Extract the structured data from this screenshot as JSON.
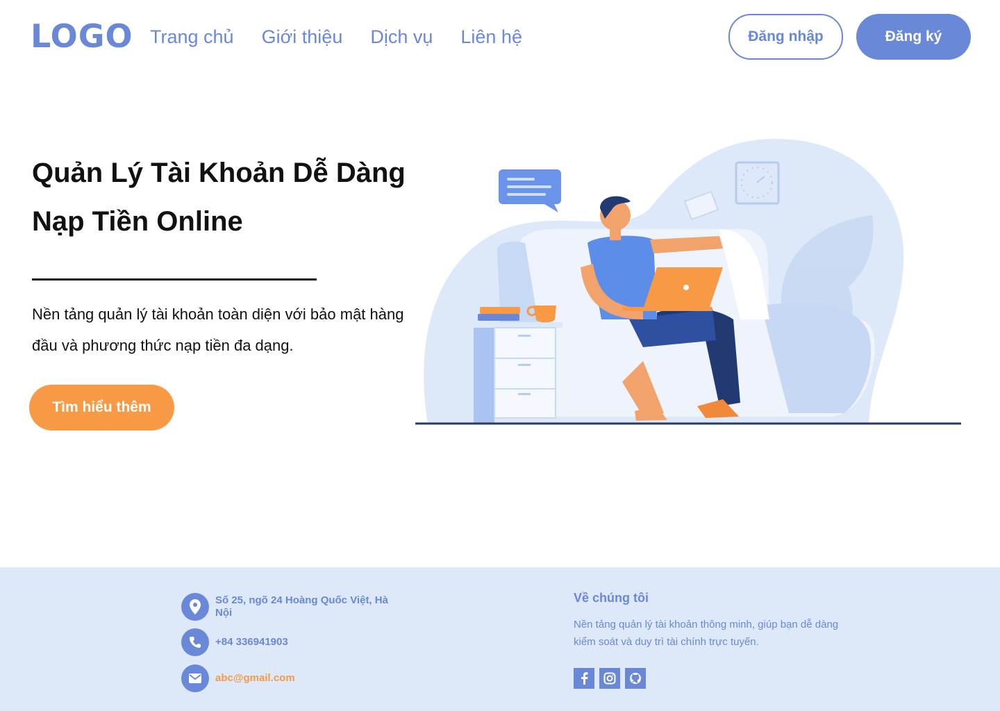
{
  "header": {
    "logo": "LOGO",
    "nav": [
      "Trang chủ",
      "Giới thiệu",
      "Dịch vụ",
      "Liên hệ"
    ],
    "login_label": "Đăng nhập",
    "register_label": "Đăng ký"
  },
  "hero": {
    "title_line1": "Quản Lý Tài Khoản Dễ Dàng",
    "title_line2": "Nạp Tiền Online",
    "description": "Nền tảng quản lý tài khoản toàn diện với bảo mật hàng đầu và phương thức nạp tiền đa dạng.",
    "cta_label": "Tìm hiểu thêm"
  },
  "footer": {
    "address": "Số 25,  ngõ 24 Hoàng Quốc Việt, Hà Nội",
    "phone": "+84 336941903",
    "email": "abc@gmail.com",
    "about_title": "Về chúng tôi",
    "about_text": "Nền tảng quản lý tài khoản thông minh, giúp bạn dễ dàng kiểm soát và duy trì tài chính trực tuyến.",
    "socials": [
      "facebook-icon",
      "instagram-icon",
      "github-icon"
    ]
  },
  "colors": {
    "primary": "#6a88d8",
    "accent": "#f89a45",
    "footer_bg": "#dde8f8"
  }
}
